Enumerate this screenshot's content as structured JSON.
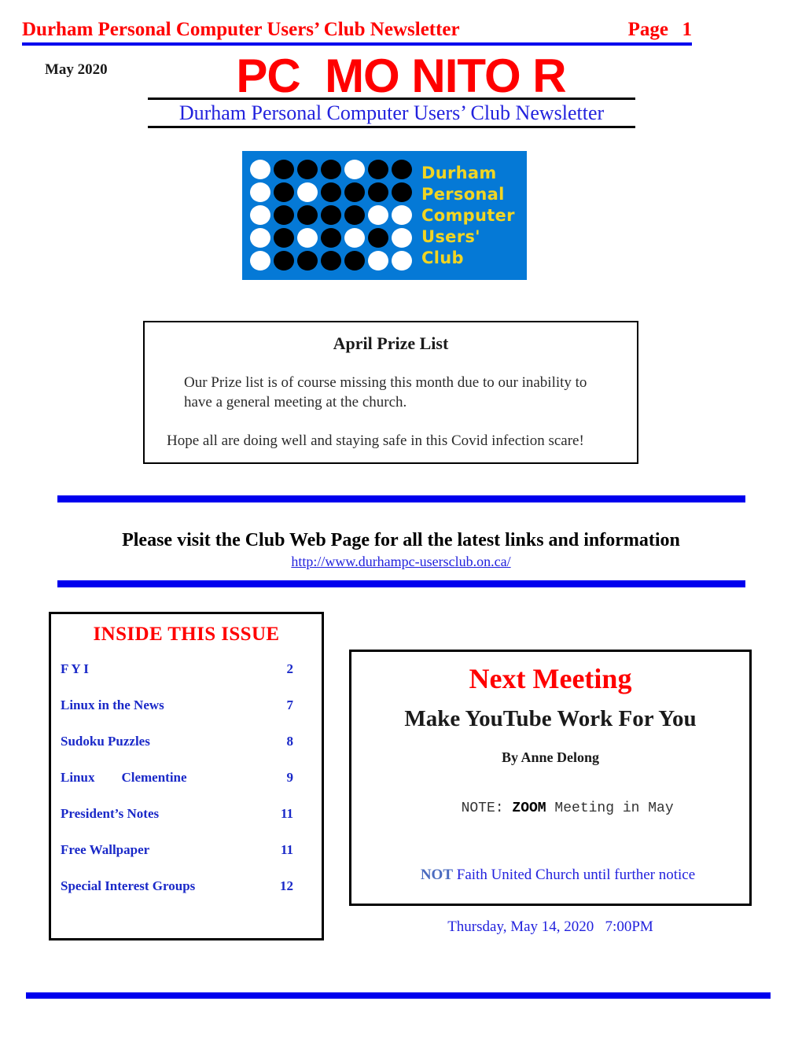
{
  "running_header": {
    "title": "Durham Personal Computer Users’ Club Newsletter",
    "page_label": "Page",
    "page_number": "1",
    "text_color": "#ff0000",
    "rule_color": "#0000ee"
  },
  "masthead": {
    "issue_date": "May 2020",
    "title": "PC  MO NITO R",
    "subtitle": "Durham Personal Computer Users’ Club Newsletter",
    "title_color": "#ff0000",
    "subtitle_color": "#2222dd"
  },
  "logo": {
    "background_color": "#0579d6",
    "dot_white_color": "#ffffff",
    "dot_black_color": "#000000",
    "wordmark_color": "#f2d522",
    "wordmark_lines": [
      "Durham",
      "Personal",
      "Computer",
      "Users'",
      "Club"
    ],
    "dot_grid": [
      [
        "w",
        "b",
        "b",
        "b",
        "w",
        "b",
        "b"
      ],
      [
        "w",
        "b",
        "w",
        "b",
        "b",
        "b",
        "b"
      ],
      [
        "w",
        "b",
        "b",
        "b",
        "b",
        "w",
        "w"
      ],
      [
        "w",
        "b",
        "w",
        "b",
        "w",
        "b",
        "w"
      ],
      [
        "w",
        "b",
        "b",
        "b",
        "b",
        "w",
        "w"
      ]
    ]
  },
  "prize_box": {
    "title": "April Prize List",
    "paragraph_1": "Our Prize list is of course missing this month due to our inability to have a general meeting at the church.",
    "paragraph_2": "Hope all are doing well and staying safe in this Covid infection scare!"
  },
  "web_promo": {
    "headline": "Please visit the Club Web Page for all the latest links and information",
    "url": "http://www.durhampc-usersclub.on.ca/",
    "bar_color": "#0000ee",
    "url_color": "#2222dd"
  },
  "table_of_contents": {
    "heading": "INSIDE THIS ISSUE",
    "heading_color": "#ff0000",
    "entry_color": "#1a29c8",
    "entries": [
      {
        "title": "F Y I",
        "page": "2"
      },
      {
        "title": "Linux in the News",
        "page": "7"
      },
      {
        "title": "Sudoku Puzzles",
        "page": "8"
      },
      {
        "title": "Linux        Clementine",
        "page": "9"
      },
      {
        "title": "President’s Notes",
        "page": "11"
      },
      {
        "title": "Free Wallpaper",
        "page": "11"
      },
      {
        "title": "Special Interest Groups",
        "page": "12"
      }
    ]
  },
  "next_meeting": {
    "heading": "Next Meeting",
    "heading_color": "#ff0000",
    "topic": "Make YouTube Work For You",
    "presenter": "By Anne Delong",
    "note_prefix": "NOTE: ",
    "note_emphasis": "ZOOM",
    "note_suffix": " Meeting in May",
    "venue_negation": "NOT",
    "venue_text": " Faith United Church until further notice",
    "datetime": "Thursday, May 14, 2020   7:00PM",
    "text_color": "#2222dd"
  },
  "footer": {
    "bar_color": "#0000ee"
  }
}
